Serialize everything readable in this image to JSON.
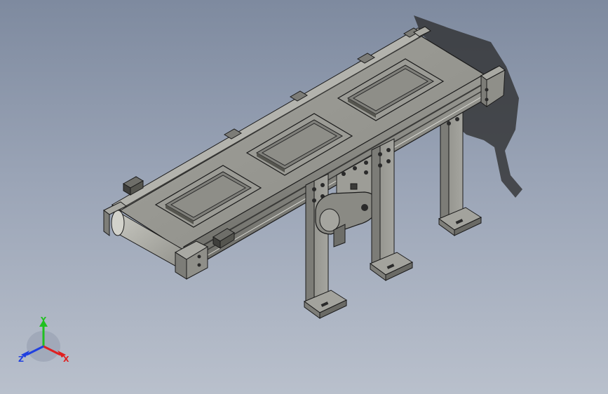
{
  "viewport": {
    "background_top": "#7e8a9f",
    "background_bottom": "#b9c0cc"
  },
  "model": {
    "part_color": "#8f8f8a",
    "part_dark": "#5c5c58",
    "part_light": "#b4b4ae",
    "edge_color": "#1a1a1a",
    "shadow_color": "#2a2a2a",
    "pallet_count": 3,
    "leg_count": 3
  },
  "triad": {
    "x_label": "X",
    "y_label": "Y",
    "z_label": "Z",
    "x_color": "#e02020",
    "y_color": "#20c020",
    "z_color": "#2040e0",
    "x_icon": "arrow-right-icon",
    "y_icon": "arrow-up-icon",
    "z_icon": "arrow-left-icon"
  }
}
